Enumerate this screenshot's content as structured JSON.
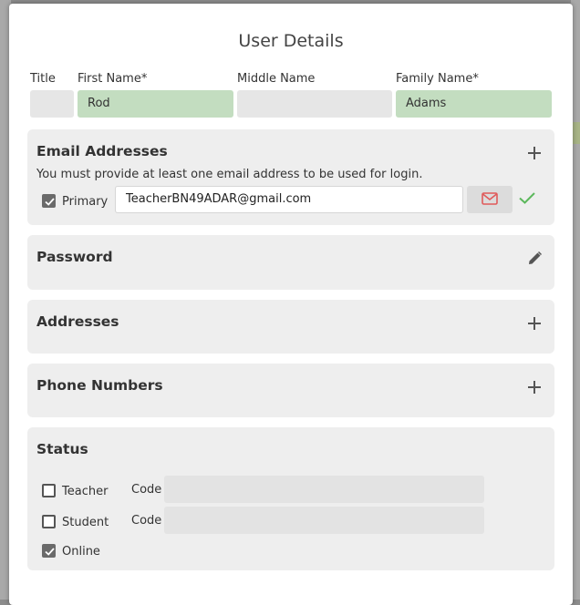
{
  "dialog": {
    "title": "User Details"
  },
  "name": {
    "title_label": "Title",
    "title_value": "",
    "first_label": "First Name*",
    "first_value": "Rod",
    "middle_label": "Middle Name",
    "middle_value": "",
    "family_label": "Family Name*",
    "family_value": "Adams"
  },
  "email": {
    "heading": "Email Addresses",
    "hint": "You must provide at least one email address to be used for login.",
    "primary_label": "Primary",
    "primary_checked": true,
    "address": "TeacherBN49ADAR@gmail.com"
  },
  "password": {
    "heading": "Password"
  },
  "addresses": {
    "heading": "Addresses"
  },
  "phones": {
    "heading": "Phone Numbers"
  },
  "status": {
    "heading": "Status",
    "teacher_label": "Teacher",
    "teacher_checked": false,
    "student_label": "Student",
    "student_checked": false,
    "online_label": "Online",
    "online_checked": true,
    "code_label": "Code"
  },
  "icons": {
    "add": "plus-icon",
    "edit": "pencil-icon",
    "mail": "envelope-icon",
    "verified": "check-icon",
    "checked": "checkbox-checked",
    "unchecked": "checkbox-unchecked"
  },
  "colors": {
    "valid_field": "#c3ddc0",
    "card_bg": "#eeeeee",
    "mail_icon": "#e05a5a",
    "verified_check": "#5cb85c"
  }
}
